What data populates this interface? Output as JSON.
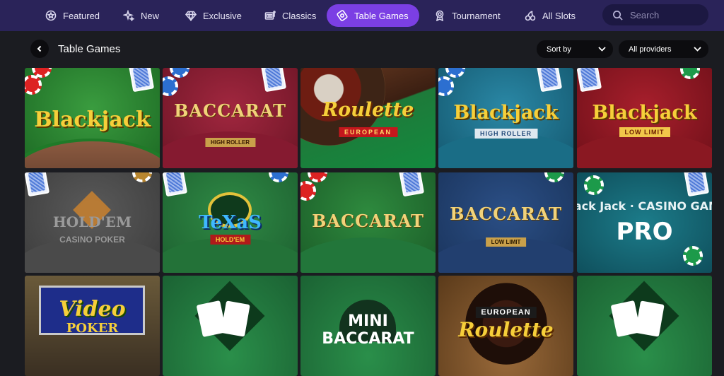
{
  "nav": {
    "items": [
      {
        "label": "Featured",
        "icon": "star-icon"
      },
      {
        "label": "New",
        "icon": "sparkle-icon"
      },
      {
        "label": "Exclusive",
        "icon": "diamond-icon"
      },
      {
        "label": "Classics",
        "icon": "slot-machine-icon"
      },
      {
        "label": "Table Games",
        "icon": "chip-icon",
        "active": true
      },
      {
        "label": "Tournament",
        "icon": "medal-icon"
      },
      {
        "label": "All Slots",
        "icon": "cherries-icon"
      }
    ],
    "search_placeholder": "Search"
  },
  "header": {
    "title": "Table Games",
    "sort_label": "Sort by",
    "providers_label": "All providers"
  },
  "games": [
    {
      "title": "Blackjack",
      "subtitle": "",
      "theme": "green"
    },
    {
      "title": "BACCARAT",
      "subtitle": "HIGH ROLLER",
      "theme": "maroon"
    },
    {
      "title": "Roulette",
      "subtitle": "EUROPEAN",
      "theme": "roulette"
    },
    {
      "title": "Blackjack",
      "subtitle": "HIGH ROLLER",
      "theme": "teal"
    },
    {
      "title": "Blackjack",
      "subtitle": "LOW LIMIT",
      "theme": "red"
    },
    {
      "title": "HOLD'EM",
      "subtitle": "CASINO POKER",
      "theme": "grey"
    },
    {
      "title": "TeXaS",
      "subtitle": "HOLD'EM",
      "theme": "green2"
    },
    {
      "title": "BACCARAT",
      "subtitle": "",
      "theme": "green3"
    },
    {
      "title": "BACCARAT",
      "subtitle": "LOW LIMIT",
      "theme": "blue"
    },
    {
      "title": "PRO",
      "subtitle": "Black Jack · CASINO GAME",
      "theme": "tealpro"
    },
    {
      "title": "Video",
      "subtitle": "POKER",
      "theme": "video"
    },
    {
      "title": "",
      "subtitle": "",
      "theme": "green4"
    },
    {
      "title": "MINI BACCARAT",
      "subtitle": "",
      "theme": "green5"
    },
    {
      "title": "Roulette",
      "subtitle": "EUROPEAN",
      "theme": "wood"
    },
    {
      "title": "",
      "subtitle": "",
      "theme": "green6"
    }
  ]
}
